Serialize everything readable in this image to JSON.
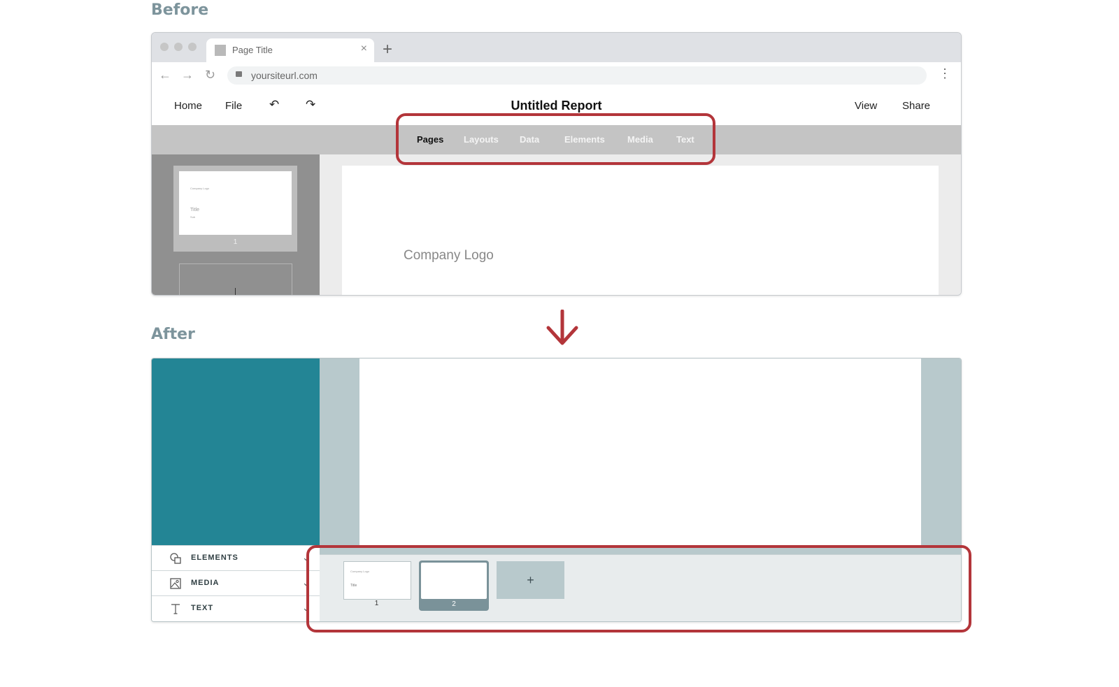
{
  "labels": {
    "before": "Before",
    "after": "After"
  },
  "browser": {
    "tab_title": "Page Title",
    "tab_close": "×",
    "new_tab": "+",
    "url": "yoursiteurl.com",
    "back": "←",
    "forward": "→",
    "reload": "↻",
    "menu": "⋮"
  },
  "app_header": {
    "home": "Home",
    "file": "File",
    "undo": "↶",
    "redo": "↷",
    "title": "Untitled Report",
    "view": "View",
    "share": "Share"
  },
  "toolbar": {
    "items": [
      "Pages",
      "Layouts",
      "Data",
      "Elements",
      "Media",
      "Text"
    ],
    "active": "Pages"
  },
  "before_pages": {
    "thumb_company": "Company Logo",
    "thumb_title": "Title",
    "thumb_subtitle": "Sub",
    "page_number": "1"
  },
  "before_canvas": {
    "logo_text": "Company Logo"
  },
  "after_sidebar": {
    "accordion": [
      {
        "icon": "shapes-icon",
        "label": "ELEMENTS"
      },
      {
        "icon": "image-icon",
        "label": "MEDIA"
      },
      {
        "icon": "text-icon",
        "label": "TEXT"
      }
    ],
    "chevron": "⌄"
  },
  "after_pages": {
    "page1_number": "1",
    "page2_number": "2",
    "add_page": "+",
    "thumb_company": "Company Logo",
    "thumb_title": "Title",
    "selected_page": 2
  },
  "colors": {
    "highlight": "#b3353a",
    "teal": "#238595",
    "label": "#7d949c"
  }
}
